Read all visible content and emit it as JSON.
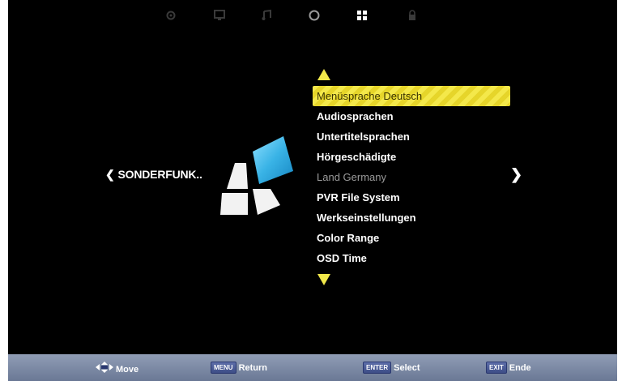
{
  "top_icons": [
    "settings-icon",
    "picture-icon",
    "music-icon",
    "circle-icon",
    "apps-icon",
    "lock-icon"
  ],
  "active_top_icon": "apps-icon",
  "source_label": "SONDERFUNK..",
  "menu": {
    "items": [
      {
        "label": "Menüsprache Deutsch",
        "state": "selected"
      },
      {
        "label": "Audiosprachen",
        "state": "normal"
      },
      {
        "label": "Untertitelsprachen",
        "state": "normal"
      },
      {
        "label": "Hörgeschädigte",
        "state": "normal"
      },
      {
        "label": "Land Germany",
        "state": "disabled"
      },
      {
        "label": "PVR File System",
        "state": "normal"
      },
      {
        "label": "Werkseinstellungen",
        "state": "normal"
      },
      {
        "label": "Color Range",
        "state": "normal"
      },
      {
        "label": "OSD Time",
        "state": "normal"
      }
    ]
  },
  "hints": [
    {
      "key": "",
      "label": "Move"
    },
    {
      "key": "MENU",
      "label": "Return"
    },
    {
      "key": "ENTER",
      "label": "Select"
    },
    {
      "key": "EXIT",
      "label": "Ende"
    }
  ],
  "colors": {
    "background": "#000000",
    "highlight": "#f4e84a",
    "accent_arrow": "#f1e84a",
    "bottom_bar": "#7d8aa6",
    "logo_blue": "#3fb6e6"
  }
}
